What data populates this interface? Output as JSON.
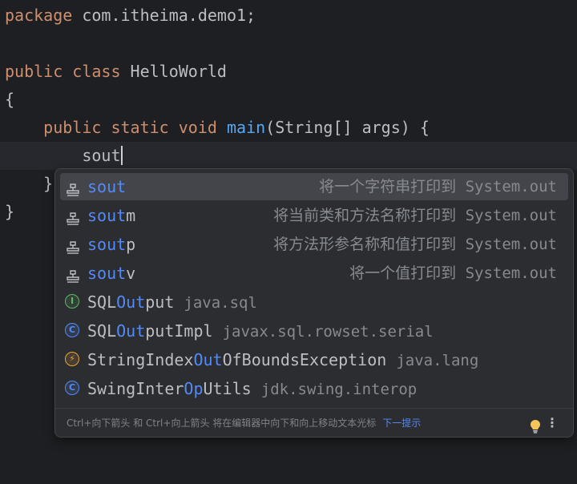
{
  "editor": {
    "lines": {
      "package": {
        "kw": "package",
        "rest": " com.itheima.demo1;"
      },
      "class": {
        "kw1": "public",
        "kw2": "class",
        "rest": " HelloWorld"
      },
      "open_brace": "{",
      "main": {
        "kw1": "public",
        "kw2": "static",
        "kw3": "void",
        "fn": "main",
        "rest": "(String[] args) {"
      },
      "typed": "sout",
      "close_inner": "}",
      "close_outer": "}"
    }
  },
  "completion": {
    "items": [
      {
        "icon": "template-icon",
        "match": "sout",
        "suffix": "",
        "desc": "将一个字符串打印到 System.out",
        "selected": true
      },
      {
        "icon": "template-icon",
        "match": "sout",
        "suffix": "m",
        "desc": "将当前类和方法名称打印到 System.out"
      },
      {
        "icon": "template-icon",
        "match": "sout",
        "suffix": "p",
        "desc": "将方法形参名称和值打印到 System.out"
      },
      {
        "icon": "template-icon",
        "match": "sout",
        "suffix": "v",
        "desc": "将一个值打印到 System.out"
      },
      {
        "icon": "interface-icon",
        "p1": "SQL",
        "h1": "Out",
        "p2": "put",
        "pkg": "java.sql"
      },
      {
        "icon": "class-icon",
        "p1": "SQL",
        "h1": "Out",
        "p2": "putImpl",
        "pkg": "javax.sql.rowset.serial"
      },
      {
        "icon": "exception-class-icon",
        "p1": "StringIndex",
        "h1": "Out",
        "p2": "OfBoundsException",
        "pkg": "java.lang"
      },
      {
        "icon": "class-icon",
        "p1": "SwingInter",
        "h1": "Op",
        "p2": "Utils",
        "pkg": "jdk.swing.interop"
      }
    ],
    "icon_letters": {
      "interface": "I",
      "class": "C",
      "exception": "⚡"
    },
    "footer": {
      "hint": "Ctrl+向下箭头 和 Ctrl+向上箭头 将在编辑器中向下和向上移动文本光标",
      "next_tip": "下一提示",
      "more": "⋮"
    }
  },
  "colors": {
    "background": "#1e1f22",
    "keyword": "#cf8e6d",
    "method": "#56a8f5",
    "match_highlight": "#548af7",
    "popup_bg": "#2b2d30",
    "selected_bg": "#43454a"
  }
}
